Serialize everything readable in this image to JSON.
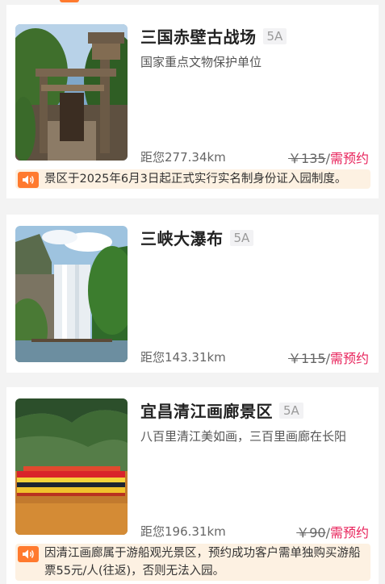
{
  "attractions": [
    {
      "name": "三国赤壁古战场",
      "level": "5A",
      "description": "国家重点文物保护单位",
      "distance": "距您277.34km",
      "price": "￥135",
      "price_suffix": "/",
      "price_note": "需预约",
      "image_icon": "ancient-gate-photo",
      "notice": "景区于2025年6月3日起正式实行实名制身份证入园制度。"
    },
    {
      "name": "三峡大瀑布",
      "level": "5A",
      "description": "",
      "distance": "距您143.31km",
      "price": "￥115",
      "price_suffix": "/",
      "price_note": "需预约",
      "image_icon": "waterfall-photo"
    },
    {
      "name": "宜昌清江画廊景区",
      "level": "5A",
      "description": "八百里清江美如画，三百里画廊在长阳",
      "distance": "距您196.31km",
      "price": "￥90",
      "price_suffix": "/",
      "price_note": "需预约",
      "image_icon": "river-cruise-photo",
      "notice": "因清江画廊属于游船观光景区，预约成功客户需单独购买游船票55元/人(往返)，否则无法入园。"
    }
  ],
  "colors": {
    "accent": "#ff7a2e",
    "price_note": "#e8215a",
    "notice_bg": "#fdf1e2"
  }
}
